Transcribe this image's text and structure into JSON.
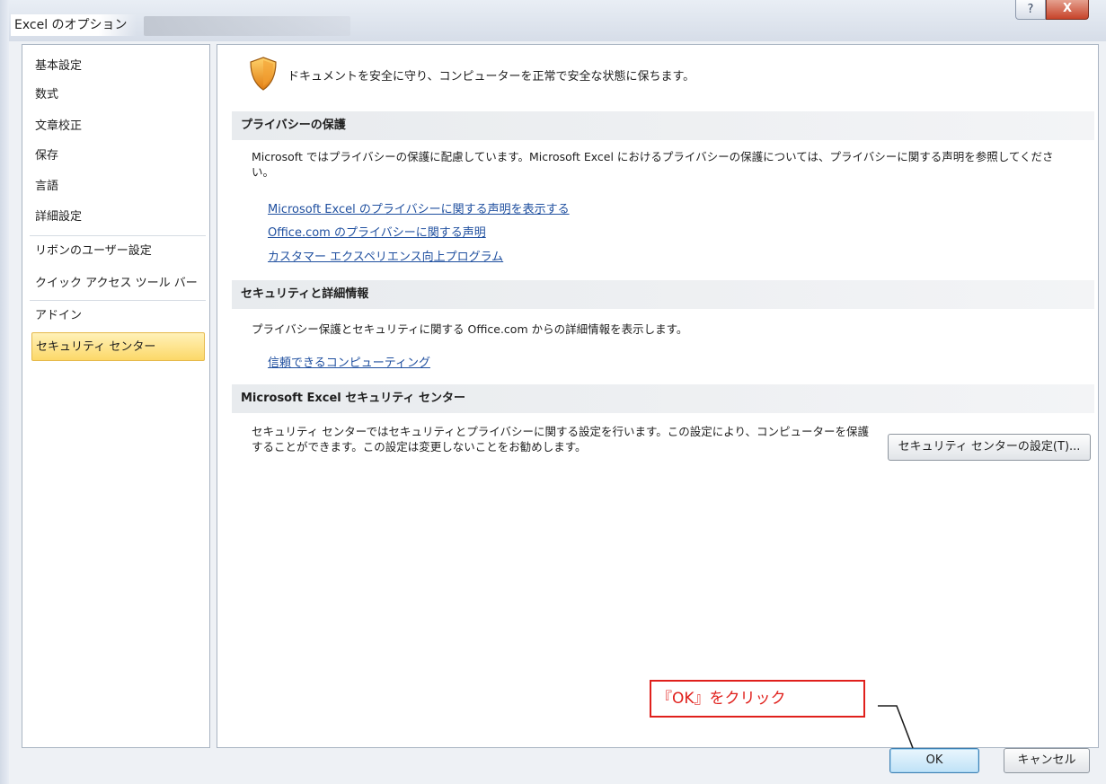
{
  "window": {
    "title": "Excel のオプション",
    "help_glyph": "?",
    "close_glyph": "X"
  },
  "sidebar": {
    "items": [
      {
        "label": "基本設定"
      },
      {
        "label": "数式"
      },
      {
        "label": "文章校正"
      },
      {
        "label": "保存"
      },
      {
        "label": "言語"
      },
      {
        "label": "詳細設定"
      },
      {
        "label": "リボンのユーザー設定"
      },
      {
        "label": "クイック アクセス ツール バー"
      },
      {
        "label": "アドイン"
      },
      {
        "label": "セキュリティ センター",
        "selected": true
      }
    ]
  },
  "main": {
    "intro": "ドキュメントを安全に守り、コンピューターを正常で安全な状態に保ちます。",
    "privacy": {
      "header": "プライバシーの保護",
      "text": "Microsoft ではプライバシーの保護に配慮しています。Microsoft Excel におけるプライバシーの保護については、プライバシーに関する声明を参照してください。",
      "links": [
        "Microsoft Excel のプライバシーに関する声明を表示する",
        "Office.com のプライバシーに関する声明",
        "カスタマー エクスペリエンス向上プログラム"
      ]
    },
    "security": {
      "header": "セキュリティと詳細情報",
      "text": "プライバシー保護とセキュリティに関する Office.com からの詳細情報を表示します。",
      "link": "信頼できるコンピューティング"
    },
    "trust_center": {
      "header": "Microsoft Excel セキュリティ センター",
      "text": "セキュリティ センターではセキュリティとプライバシーに関する設定を行います。この設定により、コンピューターを保護することができます。この設定は変更しないことをお勧めします。",
      "button": "セキュリティ センターの設定(T)..."
    }
  },
  "footer": {
    "ok_label": "OK",
    "cancel_label": "キャンセル"
  },
  "annotation": {
    "text": "『OK』をクリック",
    "color": "#e0201c"
  },
  "colors": {
    "selected_nav": "#fcd868",
    "link": "#1f4f9f"
  },
  "icons": {
    "header": "shield-icon"
  }
}
